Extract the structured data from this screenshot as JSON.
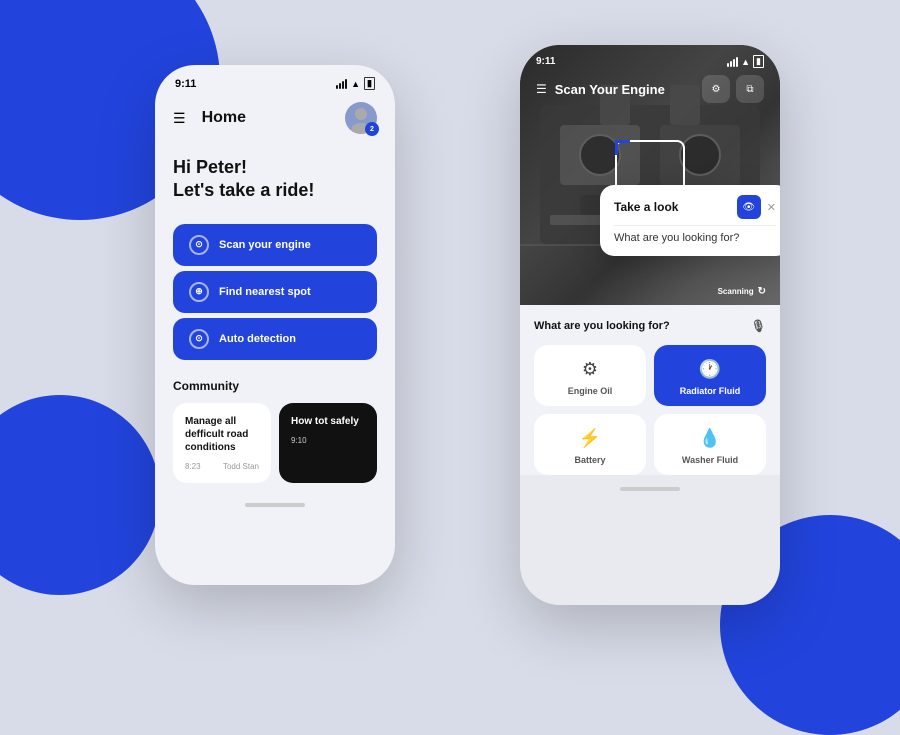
{
  "background": {
    "color": "#d8dce8"
  },
  "phone_left": {
    "time": "9:11",
    "header": {
      "title": "Home",
      "badge": "2"
    },
    "greeting": {
      "line1": "Hi Peter!",
      "line2": "Let's take a ride!"
    },
    "buttons": [
      {
        "id": "scan",
        "label": "Scan your engine",
        "icon": "⊙"
      },
      {
        "id": "find",
        "label": "Find nearest spot",
        "icon": "⊕"
      },
      {
        "id": "auto",
        "label": "Auto detection",
        "icon": "⊙"
      }
    ],
    "community": {
      "title": "Community",
      "cards": [
        {
          "theme": "light",
          "title": "Manage all defficult road conditions",
          "time": "8:23",
          "author": "Todd Stan"
        },
        {
          "theme": "dark",
          "title": "How tot safely",
          "time": "9:10",
          "author": ""
        }
      ]
    }
  },
  "phone_right": {
    "time": "9:11",
    "title": "Scan Your Engine",
    "scanning_label": "Scanning",
    "popup": {
      "title": "Take a look",
      "question": "What are you looking for?"
    },
    "bottom": {
      "section_label": "What are you looking for?",
      "options": [
        {
          "id": "engine-oil",
          "label": "Engine Oil",
          "icon": "⚙",
          "theme": "light"
        },
        {
          "id": "radiator-fluid",
          "label": "Radiator Fluid",
          "icon": "🕐",
          "theme": "blue"
        },
        {
          "id": "battery",
          "label": "Battery",
          "icon": "⚡",
          "theme": "light"
        },
        {
          "id": "washer-fluid",
          "label": "Washer Fluid",
          "icon": "💧",
          "theme": "light"
        }
      ]
    }
  }
}
